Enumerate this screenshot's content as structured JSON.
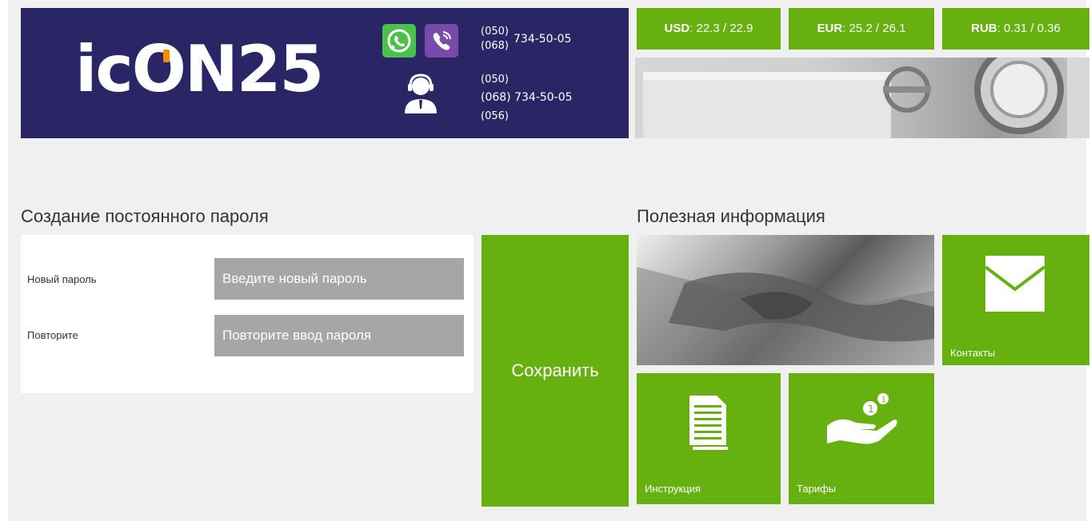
{
  "header": {
    "logo_text": "icON25",
    "phones_top": [
      "(050)",
      "(068)"
    ],
    "phones_top_number": "734-50-05",
    "phones_bottom": [
      "(050)",
      "(068) 734-50-05",
      "(056)"
    ]
  },
  "currencies": [
    {
      "code": "USD",
      "rate": ": 22.3 / 22.9"
    },
    {
      "code": "EUR",
      "rate": ": 25.2 / 26.1"
    },
    {
      "code": "RUB",
      "rate": ": 0.31 / 0.36"
    }
  ],
  "form": {
    "title": "Создание постоянного пароля",
    "new_password_label": "Новый пароль",
    "new_password_placeholder": "Введите новый пароль",
    "repeat_label": "Повторите",
    "repeat_placeholder": "Повторите ввод пароля",
    "save_label": "Сохранить"
  },
  "info": {
    "title": "Полезная информация",
    "tiles": [
      {
        "label": "Контакты",
        "icon": "envelope-icon"
      },
      {
        "label": "Инструкция",
        "icon": "document-icon"
      },
      {
        "label": "Тарифы",
        "icon": "hand-coins-icon"
      }
    ]
  },
  "colors": {
    "header_bg": "#2a2565",
    "accent_green": "#66b010",
    "input_gray": "#a6a6a6",
    "logo_accent": "#f28c00"
  }
}
